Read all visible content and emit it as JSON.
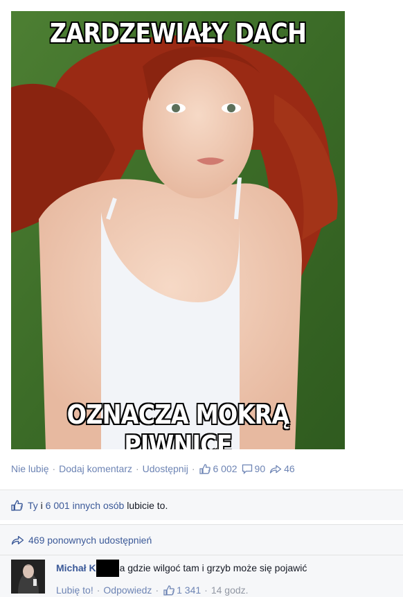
{
  "post": {
    "meme_top": "ZARDZEWIAŁY DACH",
    "meme_bottom": "OZNACZA MOKRĄ PIWNICĘ"
  },
  "actions": {
    "dislike": "Nie lubię",
    "comment": "Dodaj komentarz",
    "share": "Udostępnij",
    "like_count": "6 002",
    "comment_count": "90",
    "share_count": "46"
  },
  "likes": {
    "you": "Ty",
    "and": " i ",
    "others": "6 001 innych osób",
    "rest": " lubicie to."
  },
  "shares": {
    "label": "469 ponownych udostępnień"
  },
  "comment": {
    "author": "Michał K",
    "text": "a gdzie wilgoć tam i grzyb może się pojawić",
    "like_label": "Lubię to!",
    "reply_label": "Odpowiedz",
    "like_count": "1 341",
    "time": "14 godz."
  },
  "icons": {
    "like": "thumbs-up-icon",
    "comment": "speech-bubble-icon",
    "share": "share-arrow-icon"
  },
  "colors": {
    "link": "#6d84b4",
    "brand": "#3b5998",
    "ufi_bg": "#f6f7f9"
  }
}
